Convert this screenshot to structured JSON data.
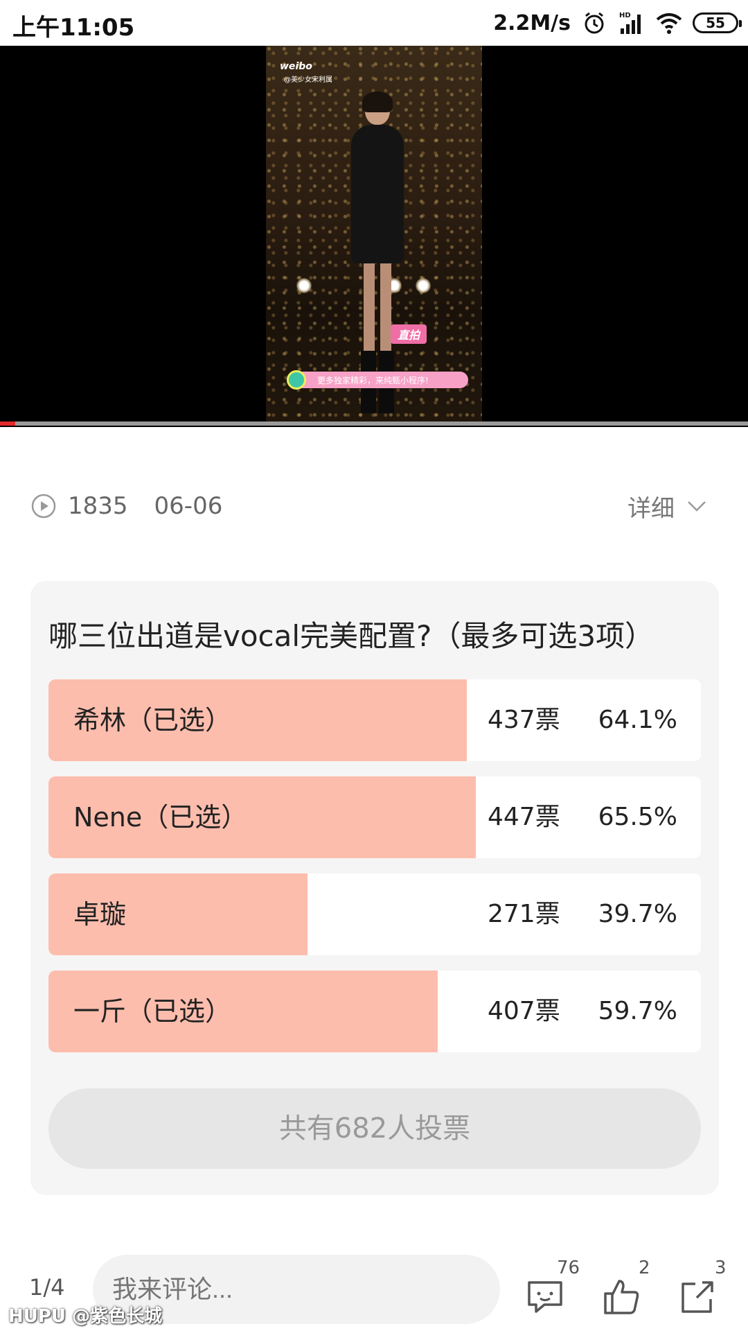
{
  "status_bar": {
    "time": "上午11:05",
    "net_speed": "2.2M/s",
    "battery": "55"
  },
  "video": {
    "progress": 0.02,
    "overlay": {
      "weibo_logo": "weibo",
      "weibo_sub": "@美少女宋利属",
      "badge": "直拍",
      "promo": "更多独家精彩，来纯甄小程序!"
    }
  },
  "meta": {
    "play_count": "1835",
    "date": "06-06",
    "detail_label": "详细"
  },
  "poll": {
    "title": "哪三位出道是vocal完美配置?（最多可选3项）",
    "options": [
      {
        "label": "希林（已选）",
        "votes": "437票",
        "percent": "64.1%",
        "fraction": 0.641
      },
      {
        "label": "Nene（已选）",
        "votes": "447票",
        "percent": "65.5%",
        "fraction": 0.655
      },
      {
        "label": "卓璇",
        "votes": "271票",
        "percent": "39.7%",
        "fraction": 0.397
      },
      {
        "label": "一斤（已选）",
        "votes": "407票",
        "percent": "59.7%",
        "fraction": 0.597
      }
    ],
    "total_label": "共有682人投票"
  },
  "bottom_bar": {
    "page_indicator": "1/4",
    "comment_placeholder": "我来评论...",
    "comment_count": "76",
    "like_count": "2",
    "share_count": "3"
  },
  "watermark": "HUPU @紫色长城",
  "colors": {
    "poll_bar": "#fdbdad",
    "progress": "#e02a2a"
  }
}
